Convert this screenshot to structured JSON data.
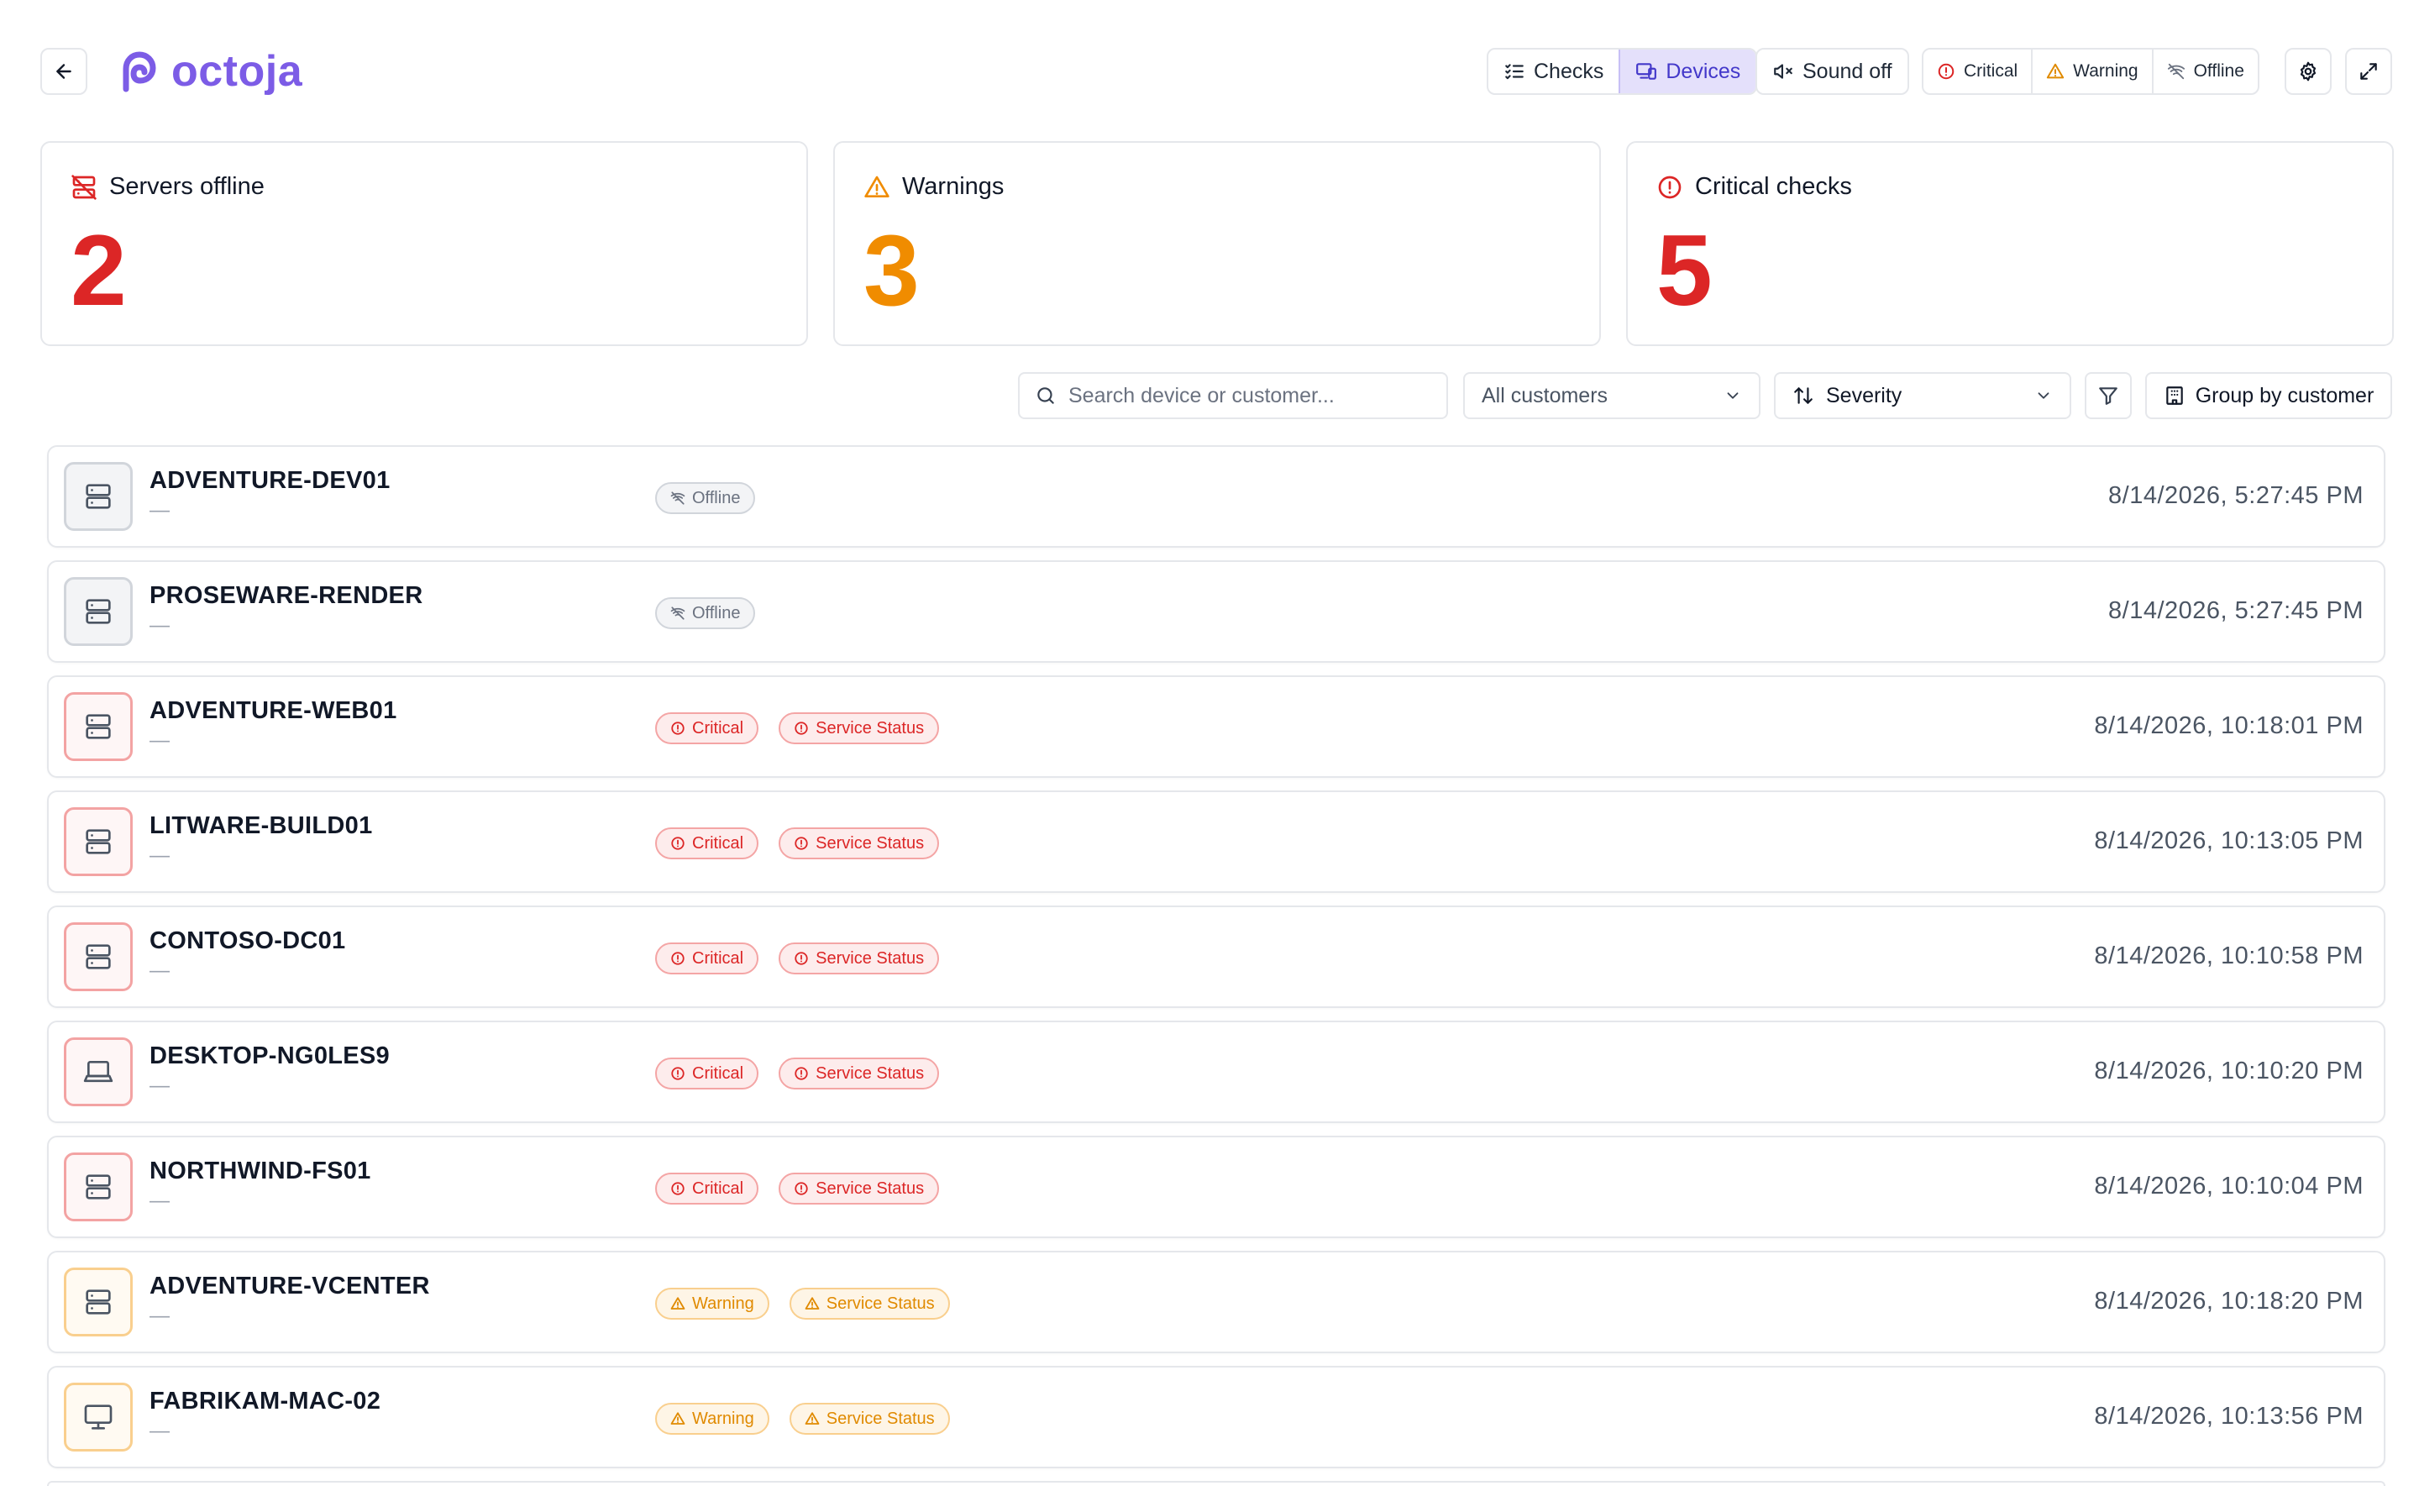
{
  "header": {
    "logo_text": "octoja",
    "nav": {
      "checks_label": "Checks",
      "devices_label": "Devices"
    },
    "sound_label": "Sound off",
    "status_filters": {
      "critical_label": "Critical",
      "warning_label": "Warning",
      "offline_label": "Offline"
    }
  },
  "stats": [
    {
      "label": "Servers offline",
      "value": "2",
      "color": "#dc2626",
      "icon": "server-off-icon"
    },
    {
      "label": "Warnings",
      "value": "3",
      "color": "#f08c00",
      "icon": "warning-triangle-icon"
    },
    {
      "label": "Critical checks",
      "value": "5",
      "color": "#dc2626",
      "icon": "alert-circle-icon"
    }
  ],
  "filters": {
    "search_placeholder": "Search device or customer...",
    "customer_select": "All customers",
    "sort_select": "Severity",
    "group_label": "Group by customer"
  },
  "colors": {
    "accent": "#7c5ce6",
    "critical": "#dc2626",
    "warning": "#f08c00",
    "offline": "#6b7280"
  },
  "devices": [
    {
      "name": "ADVENTURE-DEV01",
      "sub": "—",
      "type": "server",
      "status": "offline",
      "badges": [
        {
          "kind": "offline",
          "label": "Offline"
        }
      ],
      "time": "8/14/2026, 5:27:45 PM"
    },
    {
      "name": "PROSEWARE-RENDER",
      "sub": "—",
      "type": "server",
      "status": "offline",
      "badges": [
        {
          "kind": "offline",
          "label": "Offline"
        }
      ],
      "time": "8/14/2026, 5:27:45 PM"
    },
    {
      "name": "ADVENTURE-WEB01",
      "sub": "—",
      "type": "server",
      "status": "critical",
      "badges": [
        {
          "kind": "critical",
          "label": "Critical"
        },
        {
          "kind": "critical",
          "label": "Service Status"
        }
      ],
      "time": "8/14/2026, 10:18:01 PM"
    },
    {
      "name": "LITWARE-BUILD01",
      "sub": "—",
      "type": "server",
      "status": "critical",
      "badges": [
        {
          "kind": "critical",
          "label": "Critical"
        },
        {
          "kind": "critical",
          "label": "Service Status"
        }
      ],
      "time": "8/14/2026, 10:13:05 PM"
    },
    {
      "name": "CONTOSO-DC01",
      "sub": "—",
      "type": "server",
      "status": "critical",
      "badges": [
        {
          "kind": "critical",
          "label": "Critical"
        },
        {
          "kind": "critical",
          "label": "Service Status"
        }
      ],
      "time": "8/14/2026, 10:10:58 PM"
    },
    {
      "name": "DESKTOP-NG0LES9",
      "sub": "—",
      "type": "laptop",
      "status": "critical",
      "badges": [
        {
          "kind": "critical",
          "label": "Critical"
        },
        {
          "kind": "critical",
          "label": "Service Status"
        }
      ],
      "time": "8/14/2026, 10:10:20 PM"
    },
    {
      "name": "NORTHWIND-FS01",
      "sub": "—",
      "type": "server",
      "status": "critical",
      "badges": [
        {
          "kind": "critical",
          "label": "Critical"
        },
        {
          "kind": "critical",
          "label": "Service Status"
        }
      ],
      "time": "8/14/2026, 10:10:04 PM"
    },
    {
      "name": "ADVENTURE-VCENTER",
      "sub": "—",
      "type": "server",
      "status": "warning",
      "badges": [
        {
          "kind": "warning",
          "label": "Warning"
        },
        {
          "kind": "warning",
          "label": "Service Status"
        }
      ],
      "time": "8/14/2026, 10:18:20 PM"
    },
    {
      "name": "FABRIKAM-MAC-02",
      "sub": "—",
      "type": "desktop",
      "status": "warning",
      "badges": [
        {
          "kind": "warning",
          "label": "Warning"
        },
        {
          "kind": "warning",
          "label": "Service Status"
        }
      ],
      "time": "8/14/2026, 10:13:56 PM"
    }
  ]
}
